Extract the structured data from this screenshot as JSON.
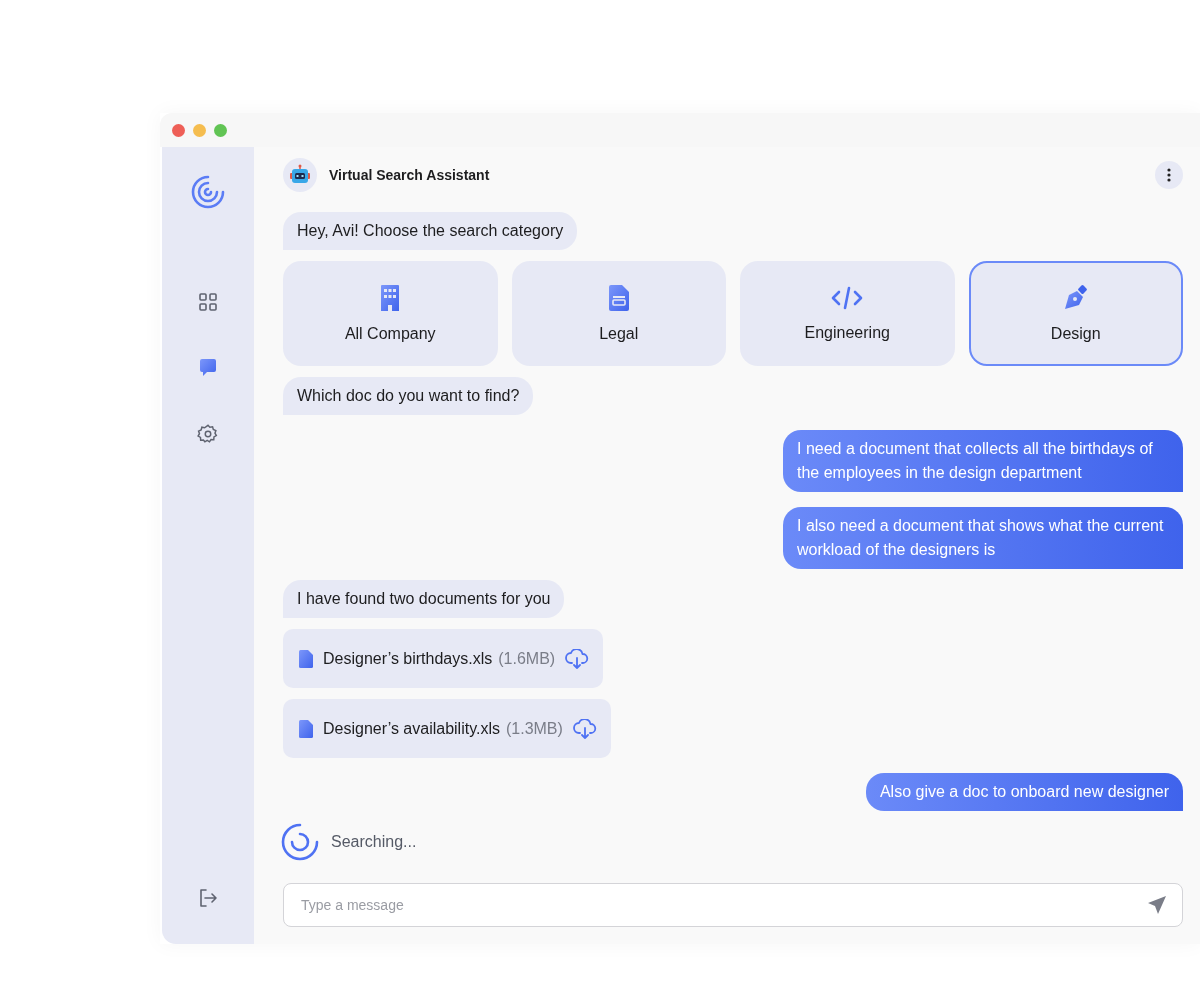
{
  "window": {
    "buttons": [
      {
        "color": "#ee5f57"
      },
      {
        "color": "#f5bd4f"
      },
      {
        "color": "#61c454"
      }
    ]
  },
  "sidebar": {
    "items": [
      {
        "selected": false
      },
      {
        "selected": true
      },
      {
        "selected": false
      }
    ]
  },
  "header": {
    "title": "Virtual Search Assistant"
  },
  "messages": [
    {
      "kind": "bot",
      "text": "Hey, Avi! Choose the search category"
    },
    {
      "kind": "categories",
      "items": [
        {
          "label": "All Company",
          "selected": false
        },
        {
          "label": "Legal",
          "selected": false
        },
        {
          "label": "Engineering",
          "selected": false
        },
        {
          "label": "Design",
          "selected": true
        }
      ]
    },
    {
      "kind": "bot",
      "text": "Which doc do you want to find?"
    },
    {
      "kind": "user",
      "text": "I need a document that collects all the birthdays of the employees in the design department"
    },
    {
      "kind": "user",
      "text": "I also need a document that shows what the current workload of the designers is"
    },
    {
      "kind": "bot",
      "text": "I have found two documents for you"
    },
    {
      "kind": "file",
      "name": "Designer’s birthdays.xls",
      "size": "(1.6MB)"
    },
    {
      "kind": "file",
      "name": "Designer’s availability.xls",
      "size": "(1.3MB)"
    },
    {
      "kind": "user",
      "text": "Also give a doc to onboard new designer"
    }
  ],
  "status": {
    "text": "Searching..."
  },
  "composer": {
    "placeholder": "Type a message"
  }
}
